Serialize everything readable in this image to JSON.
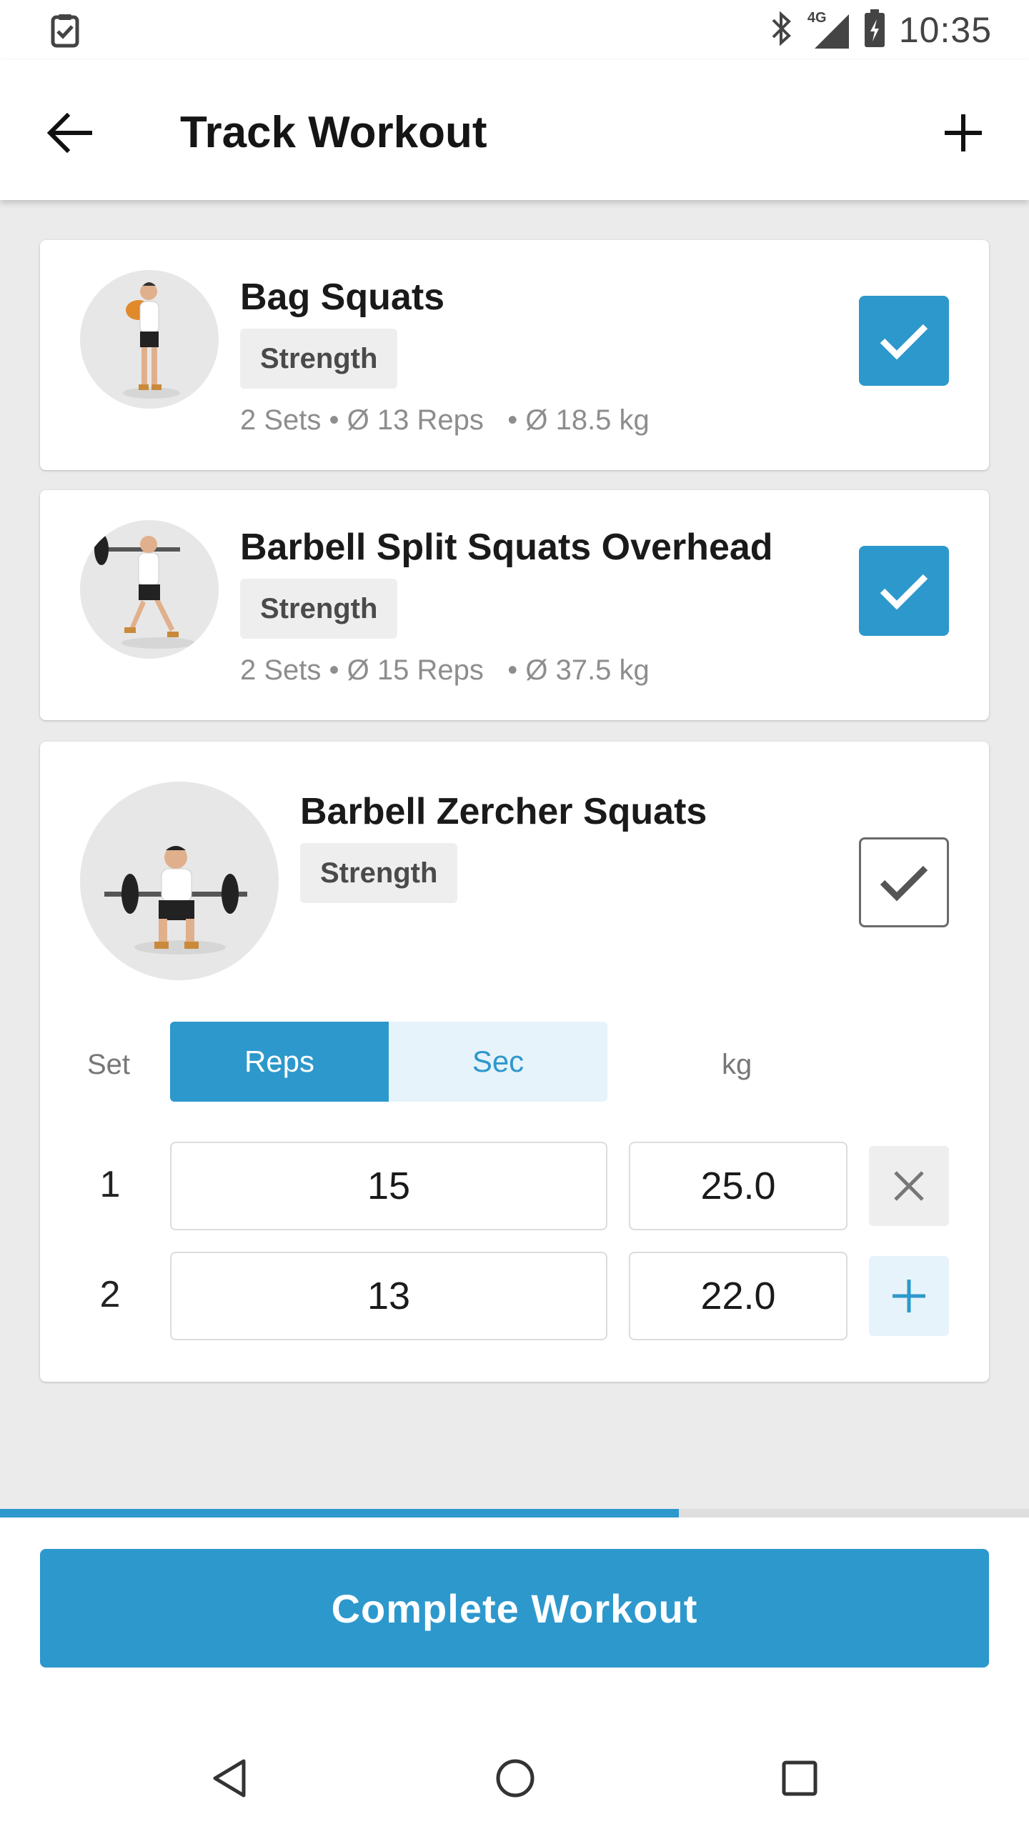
{
  "status_bar": {
    "time": "10:35",
    "network": "4G"
  },
  "app_bar": {
    "title": "Track Workout"
  },
  "exercises": [
    {
      "name": "Bag Squats",
      "category": "Strength",
      "sets": "2 Sets",
      "reps": "Ø 13 Reps",
      "weight": "Ø 18.5 kg",
      "completed": true
    },
    {
      "name": "Barbell Split Squats Overhead",
      "category": "Strength",
      "sets": "2 Sets",
      "reps": "Ø 15 Reps",
      "weight": "Ø 37.5 kg",
      "completed": true
    },
    {
      "name": "Barbell Zercher Squats",
      "category": "Strength",
      "completed": false
    }
  ],
  "set_editor": {
    "set_label": "Set",
    "mode_options": [
      "Reps",
      "Sec"
    ],
    "selected_mode": "Reps",
    "weight_label": "kg",
    "rows": [
      {
        "set": "1",
        "reps": "15",
        "weight": "25.0",
        "action": "remove"
      },
      {
        "set": "2",
        "reps": "13",
        "weight": "22.0",
        "action": "add"
      }
    ]
  },
  "progress": {
    "fraction": 0.66
  },
  "complete_button": {
    "label": "Complete Workout"
  },
  "colors": {
    "accent": "#2d98cc",
    "background": "#ebebeb",
    "card": "#ffffff"
  },
  "icons": [
    "checklist-icon",
    "bluetooth-icon",
    "signal-icon",
    "battery-icon",
    "back-arrow-icon",
    "plus-icon",
    "checkmark-icon",
    "close-icon",
    "nav-back-icon",
    "nav-home-icon",
    "nav-recents-icon"
  ]
}
